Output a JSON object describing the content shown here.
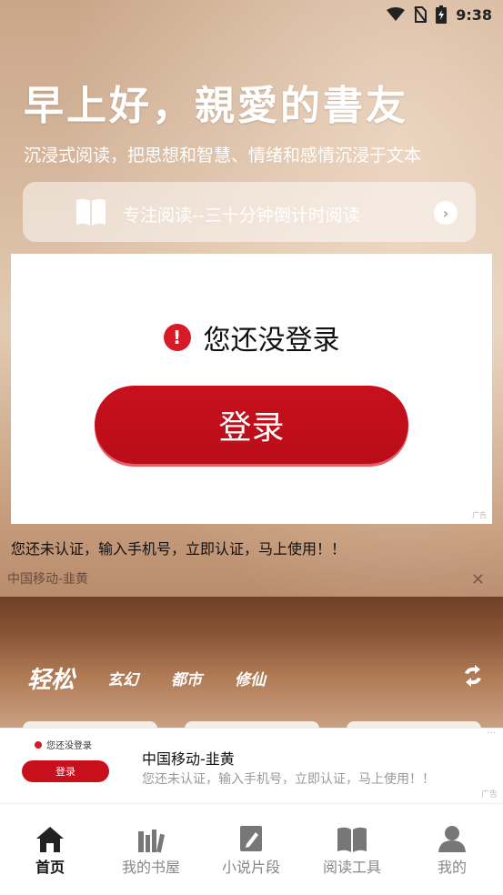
{
  "status_bar": {
    "time": "9:38"
  },
  "header": {
    "greeting": "早上好，親愛的書友",
    "subtitle": "沉浸式阅读，把思想和智慧、情绪和感情沉浸于文本"
  },
  "focus_reading": {
    "label": "专注阅读--三十分钟倒计时阅读"
  },
  "login_panel": {
    "warning": "您还没登录",
    "button": "登录",
    "ad_tag": "广告"
  },
  "verify_notice": "您还未认证，输入手机号，立即认证，马上使用！！",
  "carrier_notice": {
    "text": "中国移动-韭黄",
    "close": "✕"
  },
  "category_tabs": {
    "items": [
      {
        "label": "轻松"
      },
      {
        "label": "玄幻"
      },
      {
        "label": "都市"
      },
      {
        "label": "修仙"
      }
    ]
  },
  "banner_ad": {
    "thumb_warning": "您还没登录",
    "thumb_button": "登录",
    "title": "中国移动-韭黄",
    "description": "您还未认证，输入手机号，立即认证，马上使用！！",
    "ad_tag": "广告"
  },
  "bottom_nav": {
    "items": [
      {
        "label": "首页",
        "icon": "home-icon",
        "active": true
      },
      {
        "label": "我的书屋",
        "icon": "bookshelf-icon",
        "active": false
      },
      {
        "label": "小说片段",
        "icon": "note-pen-icon",
        "active": false
      },
      {
        "label": "阅读工具",
        "icon": "open-book-icon",
        "active": false
      },
      {
        "label": "我的",
        "icon": "user-icon",
        "active": false
      }
    ]
  }
}
